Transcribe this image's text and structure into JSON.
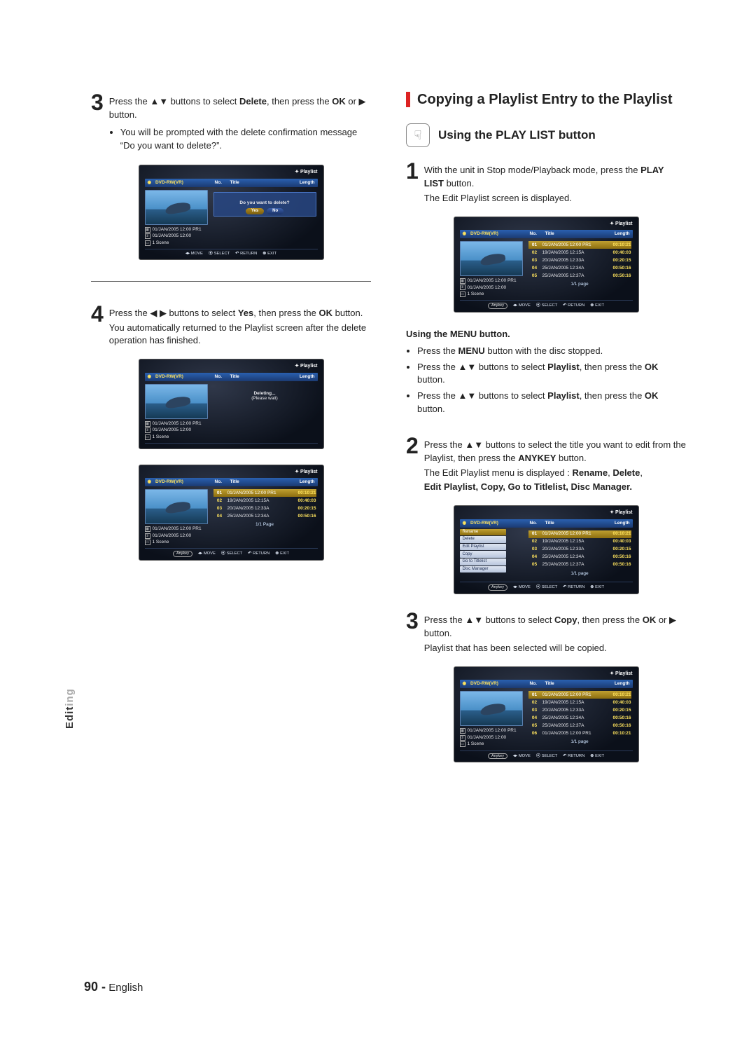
{
  "page": {
    "number": "90 -",
    "lang": "English"
  },
  "side_tab": {
    "prefix": "Edit",
    "suffix": "ing"
  },
  "left": {
    "step3": {
      "num": "3",
      "line1a": "Press the ",
      "line1b": " buttons to select ",
      "line1c": ", then press the ",
      "buttons": "▲▼",
      "target": "Delete",
      "okor": "OK",
      "or_play": " or ▶ button.",
      "bullet": "You will be prompted with the delete confirmation message “Do you want to delete?”."
    },
    "step4": {
      "num": "4",
      "line1a": "Press the ",
      "buttons": "◀ ▶",
      "line1b": " buttons to select ",
      "target": "Yes",
      "line1c": ", then press the ",
      "ok": "OK",
      "tail": " button.",
      "after": "You automatically returned to the Playlist screen after the delete operation has finished."
    }
  },
  "right": {
    "heading": "Copying a Playlist Entry to the Playlist",
    "subheading": "Using the PLAY LIST button",
    "step1": {
      "num": "1",
      "line1": "With the unit in Stop mode/Playback mode, press the ",
      "bold": "PLAY LIST",
      "tail": " button.",
      "after": "The Edit Playlist screen is displayed."
    },
    "menu_heading": "Using the MENU button.",
    "menu_bullets": [
      {
        "a": "Press the ",
        "b": "MENU",
        "c": " button with the disc stopped."
      },
      {
        "a": "Press the ",
        "arrows": "▲▼",
        "mid": " buttons to select ",
        "b": "Playlist",
        "c": ", then press the ",
        "d": "OK",
        "e": " button."
      },
      {
        "a": "Press the ",
        "arrows": "▲▼",
        "mid": " buttons to select ",
        "b": "Playlist",
        "c": ", then press the ",
        "d": "OK",
        "e": " button."
      }
    ],
    "step2": {
      "num": "2",
      "line1a": "Press the ",
      "arrows": "▲▼",
      "line1b": " buttons to select the title you want to edit from the Playlist, then press the ",
      "bold": "ANYKEY",
      "tail": " button.",
      "after1": "The Edit Playlist menu is displayed : ",
      "opts1a": "Rename",
      "opts1b": "Delete",
      "after2_bold": "Edit Playlist, Copy, Go to Titlelist, Disc Manager."
    },
    "step3": {
      "num": "3",
      "line1a": "Press the ",
      "arrows": "▲▼",
      "line1b": " buttons to select ",
      "target": "Copy",
      "line1c": ", then press the ",
      "ok": "OK",
      "or_play": " or ▶ button.",
      "after": "Playlist that has been selected will be copied."
    }
  },
  "screens": {
    "common": {
      "title": "Playlist",
      "disc": "DVD-RW(VR)",
      "cols": {
        "no": "No.",
        "title": "Title",
        "len": "Length"
      },
      "meta1": "01/JAN/2005 12:00 PR1",
      "meta2": "01/JAN/2005 12:00",
      "scene": "1 Scene",
      "foot": {
        "move": "MOVE",
        "select": "SELECT",
        "return": "RETURN",
        "exit": "EXIT",
        "anykey": "Anykey"
      }
    },
    "s1": {
      "msg": "Do you want to delete?",
      "yes": "Yes",
      "no": "No"
    },
    "s2": {
      "msg1": "Deleting...",
      "msg2": "(Please wait)"
    },
    "rows5": [
      {
        "n": "01",
        "t": "01/JAN/2005 12:00 PR1",
        "l": "00:10:21"
      },
      {
        "n": "02",
        "t": "19/JAN/2005 12:15A",
        "l": "00:40:03"
      },
      {
        "n": "03",
        "t": "20/JAN/2005 12:33A",
        "l": "00:20:15"
      },
      {
        "n": "04",
        "t": "25/JAN/2005 12:34A",
        "l": "00:50:16"
      },
      {
        "n": "05",
        "t": "25/JAN/2005 12:37A",
        "l": "00:50:16"
      }
    ],
    "rows4": [
      {
        "n": "01",
        "t": "01/JAN/2005 12:00 PR1",
        "l": "00:10:21"
      },
      {
        "n": "02",
        "t": "19/JAN/2005 12:15A",
        "l": "00:40:03"
      },
      {
        "n": "03",
        "t": "20/JAN/2005 12:33A",
        "l": "00:20:15"
      },
      {
        "n": "04",
        "t": "25/JAN/2005 12:34A",
        "l": "00:50:16"
      }
    ],
    "rows6": [
      {
        "n": "01",
        "t": "01/JAN/2005 12:00 PR1",
        "l": "00:10:21"
      },
      {
        "n": "02",
        "t": "19/JAN/2005 12:15A",
        "l": "00:40:03"
      },
      {
        "n": "03",
        "t": "20/JAN/2005 12:33A",
        "l": "00:20:15"
      },
      {
        "n": "04",
        "t": "25/JAN/2005 12:34A",
        "l": "00:50:16"
      },
      {
        "n": "05",
        "t": "25/JAN/2005 12:37A",
        "l": "00:50:16"
      },
      {
        "n": "06",
        "t": "01/JAN/2005 12:00 PR1",
        "l": "00:10:21"
      }
    ],
    "pager": "1/1 page",
    "pager2": "1/1 Page",
    "side_menu": [
      "Rename",
      "Delete",
      "Edit Playlist",
      "Copy",
      "Go to Titlelist",
      "Disc Manager"
    ]
  }
}
